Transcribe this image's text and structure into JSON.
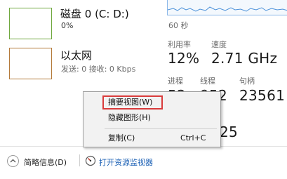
{
  "sidebar": {
    "disk": {
      "title": "磁盘 0 (C: D:)",
      "usage": "0%"
    },
    "ethernet": {
      "title": "以太网",
      "stats": "发送: 0 接收: 0 Kbps"
    }
  },
  "cpu_panel": {
    "time_label": "60 秒",
    "utilization_label": "利用率",
    "utilization_value": "12%",
    "speed_label": "速度",
    "speed_value": "2.71 GHz",
    "processes_label": "进程",
    "processes_value": "52",
    "threads_label": "线程",
    "threads_value": "952",
    "handles_label": "句柄",
    "handles_value": "23561",
    "uptime_partial": "25"
  },
  "context_menu": {
    "items": [
      {
        "label": "摘要视图(W)",
        "shortcut": ""
      },
      {
        "label": "隐藏图形(H)",
        "shortcut": ""
      },
      {
        "label": "复制(C)",
        "shortcut": "Ctrl+C"
      }
    ]
  },
  "footer": {
    "fewer_details": "简略信息(D)",
    "open_resource_monitor": "打开资源监视器"
  },
  "colors": {
    "disk_accent": "#6fa83e",
    "ethernet_accent": "#b47a3a",
    "cpu_graph": "#8bb8e8",
    "link": "#1a5fb4",
    "highlight": "#d93b3b"
  }
}
